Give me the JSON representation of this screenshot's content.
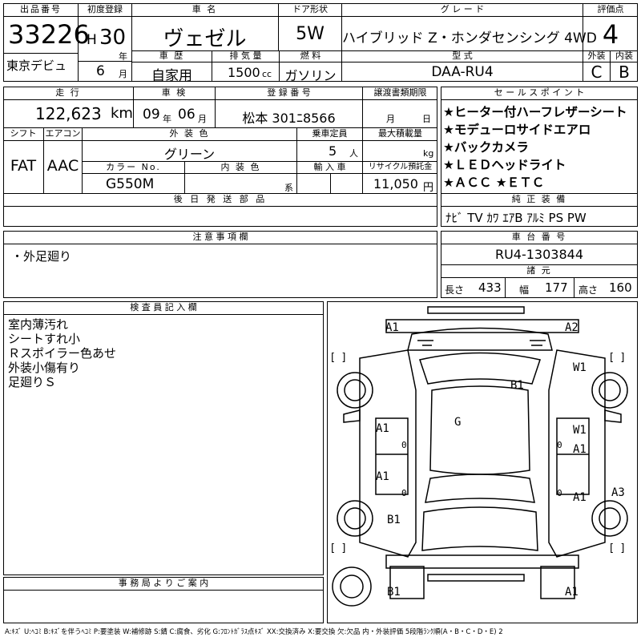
{
  "header": {
    "lot_no_label": "出品番号",
    "lot_no": "33226",
    "debut_label": "東京デビュ",
    "first_reg_label": "初度登録",
    "era": "H",
    "year": "30",
    "year_unit": "年",
    "month": "6",
    "month_unit": "月",
    "car_name_label": "車 名",
    "car_name": "ヴェゼル",
    "history_label": "車 歴",
    "history": "自家用",
    "displacement_label": "排 気 量",
    "displacement": "1500",
    "displacement_unit": "cc",
    "door_label": "ドア形状",
    "door": "5W",
    "fuel_label": "燃 料",
    "fuel": "ガソリン",
    "grade_label": "グ レ ー ド",
    "grade": "ハイブリッド Z・ホンダセンシング 4WD",
    "model_label": "型 式",
    "model": "DAA-RU4",
    "score_label": "評価点",
    "score": "4",
    "exterior_label": "外装",
    "exterior": "C",
    "interior_label": "内装",
    "interior": "B"
  },
  "info": {
    "mileage_label": "走 行",
    "mileage": "122,623",
    "mileage_unit": "km",
    "inspection_label": "車 検",
    "inspection_year": "09",
    "inspection_year_unit": "年",
    "inspection_month": "06",
    "inspection_month_unit": "月",
    "reg_no_label": "登 録 番 号",
    "reg_no": "松本 301ﾆ8566",
    "transfer_label": "譲渡書類期限",
    "transfer_month_unit": "月",
    "transfer_day_unit": "日",
    "shift_label": "シフト",
    "shift": "FAT",
    "ac_label": "エアコン",
    "ac": "AAC",
    "color_label": "外 装 色",
    "color": "グリーン",
    "capacity_label": "乗車定員",
    "capacity": "5",
    "capacity_unit": "人",
    "load_label": "最大積載量",
    "load_unit": "kg",
    "color_no_label": "カラー No.",
    "color_no": "G550M",
    "int_color_label": "内 装 色",
    "int_color_unit": "系",
    "import_label": "輸 入 車",
    "recycle_label": "リサイクル預託金",
    "recycle": "11,050",
    "recycle_unit": "円",
    "later_parts_label": "後 日 発 送 部 品"
  },
  "sales": {
    "label": "セ ー ル ス ポ イ ン ト",
    "points": [
      "★ヒーター付ハーフレザーシート",
      "★モデューロサイドエアロ",
      "★バックカメラ",
      "★ＬＥＤヘッドライト",
      "★ＡＣＣ ★ＥＴＣ"
    ],
    "equip_label": "純 正 装 備",
    "equip": "ﾅﾋﾞ TV ｶﾜ ｴｱB ｱﾙﾐ PS PW"
  },
  "notes": {
    "label": "注 意 事 項 欄",
    "text": "・外足廻り"
  },
  "chassis": {
    "label": "車 台 番 号",
    "number": "RU4-1303844",
    "spec_label": "諸 元",
    "length_label": "長さ",
    "length": "433",
    "width_label": "幅",
    "width": "177",
    "height_label": "高さ",
    "height": "160"
  },
  "inspector": {
    "label": "検 査 員 記 入 欄",
    "lines": [
      "室内薄汚れ",
      "シートすれ小",
      "Ｒスポイラー色あせ",
      "外装小傷有り",
      "足廻りＳ"
    ]
  },
  "office": {
    "label": "事 務 局 よ り ご 案 内"
  },
  "diagram": {
    "marks": {
      "a1_tl": "A1",
      "a2_tr": "A2",
      "b1_roof": "B1",
      "w1_front": "W1",
      "g_glass": "G",
      "a1_ld1": "A1",
      "a1_ld2": "A1",
      "w1_rd": "W1",
      "a1_rd1": "A1",
      "a1_rd2": "A1",
      "a3_r": "A3",
      "b1_lw": "B1",
      "b1_bl": "B1",
      "a1_br": "A1",
      "zero1": "0",
      "zero2": "0",
      "zero3": "0",
      "zero4": "0"
    }
  },
  "legend": "A:ｷｽﾞ U:ﾍｺﾐ B:ｷｽﾞを伴うﾍｺﾐ P:要塗装 W:補修跡 S:錆 C:腐食、劣化 G:ﾌﾛﾝﾄｶﾞﾗｽ点ｷｽﾞ XX:交換済み X:要交換 欠:欠品 内・外装評価 5段階ﾗﾝｸ順(A・B・C・D・E) 2"
}
